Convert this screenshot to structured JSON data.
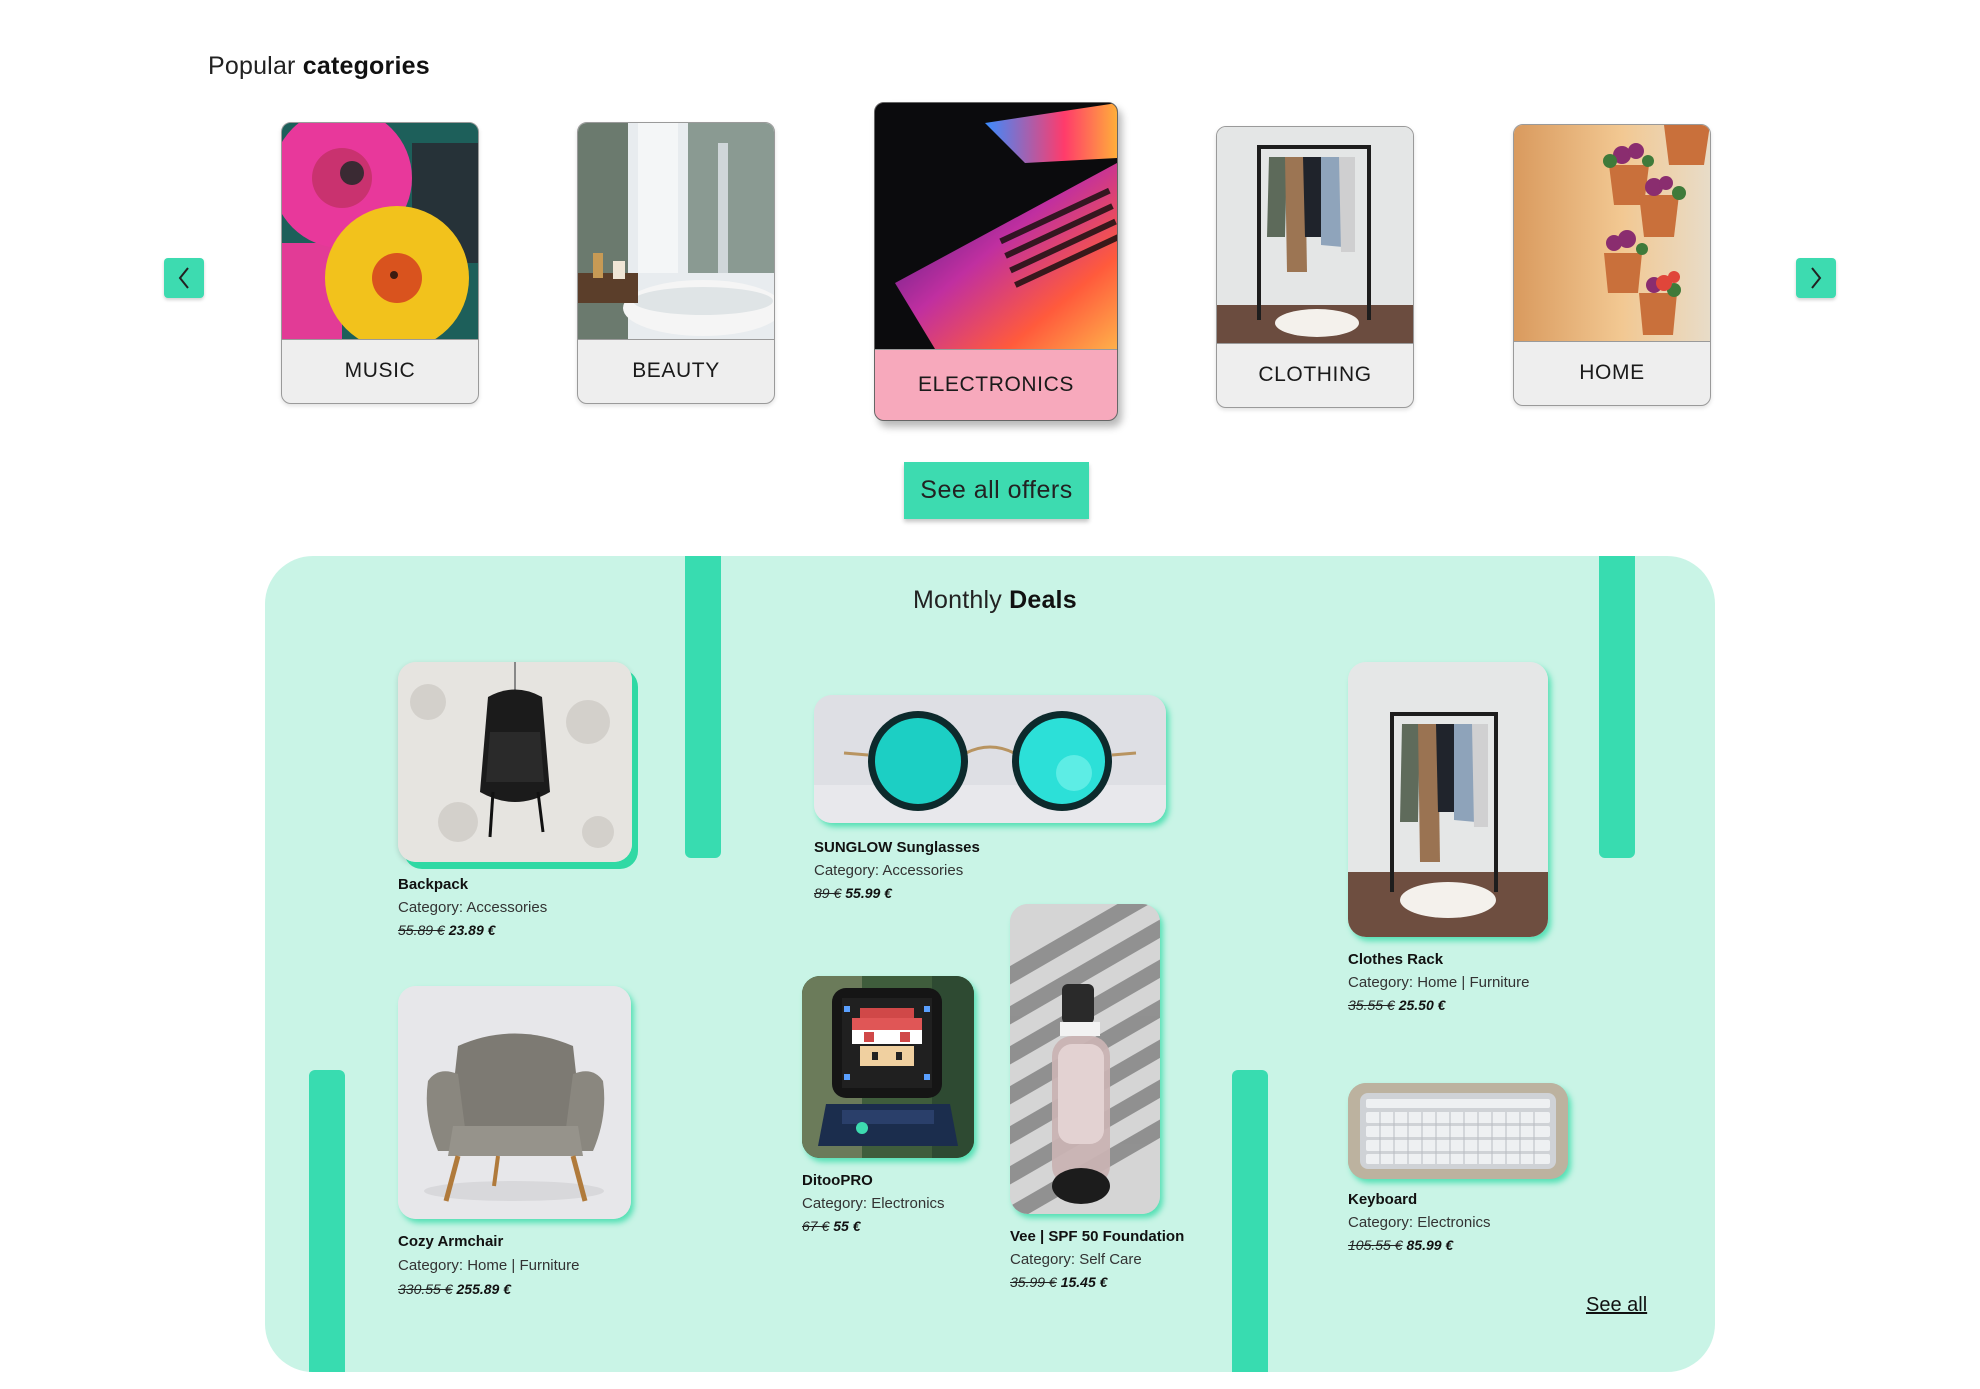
{
  "categories_section": {
    "title_light": "Popular",
    "title_bold": "categories"
  },
  "categories": [
    {
      "label": "MUSIC"
    },
    {
      "label": "BEAUTY"
    },
    {
      "label": "ELECTRONICS",
      "active": true
    },
    {
      "label": "CLOTHING"
    },
    {
      "label": "HOME"
    }
  ],
  "carousel": {
    "prev_icon": "chevron-left-icon",
    "next_icon": "chevron-right-icon"
  },
  "cta": {
    "label": "See all offers"
  },
  "deals": {
    "title_light": "Monthly",
    "title_bold": "Deals",
    "see_all": "See all",
    "products": [
      {
        "name": "Backpack",
        "category": "Category: Accessories",
        "old_price": "55.89 €",
        "price": "23.89 €"
      },
      {
        "name": "SUNGLOW Sunglasses",
        "category": "Category: Accessories",
        "old_price": "89 €",
        "price": "55.99 €"
      },
      {
        "name": "Clothes Rack",
        "category": "Category: Home | Furniture",
        "old_price": "35.55 €",
        "price": "25.50 €"
      },
      {
        "name": "Cozy Armchair",
        "category": "Category: Home | Furniture",
        "old_price": "330.55 €",
        "price": "255.89 €"
      },
      {
        "name": "DitooPRO",
        "category": "Category: Electronics",
        "old_price": "67 €",
        "price": "55 €"
      },
      {
        "name": "Vee | SPF 50 Foundation",
        "category": "Category: Self Care",
        "old_price": "35.99 €",
        "price": "15.45 €"
      },
      {
        "name": "Keyboard",
        "category": "Category: Electronics",
        "old_price": "105.55 €",
        "price": "85.99 €"
      }
    ]
  },
  "colors": {
    "accent": "#3ddbb0",
    "panel": "#c9f4e6",
    "active_card": "#f7a9bc"
  }
}
